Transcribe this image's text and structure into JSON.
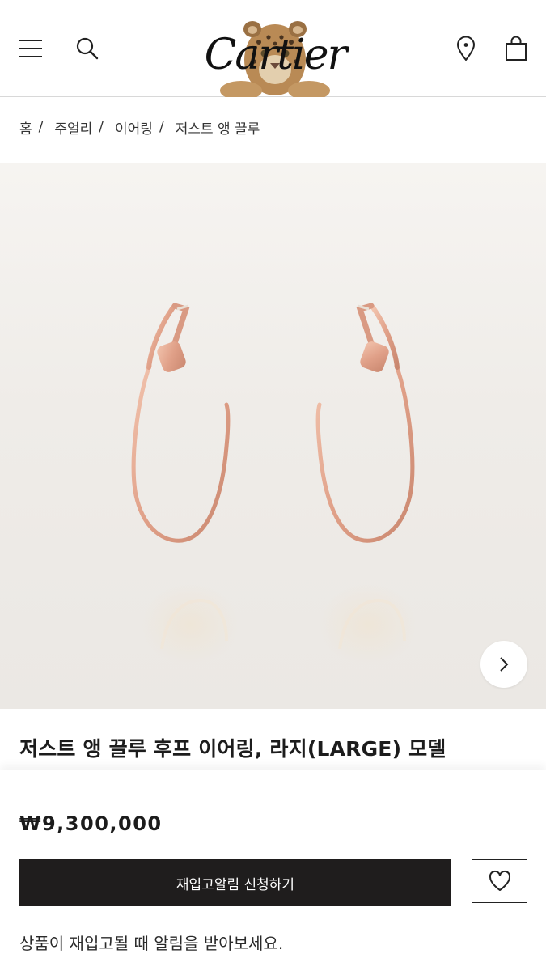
{
  "header": {
    "logo_text": "Cartier",
    "icons": {
      "menu": "hamburger-menu-icon",
      "search": "search-icon",
      "store": "location-pin-icon",
      "bag": "shopping-bag-icon"
    }
  },
  "breadcrumb": {
    "items": [
      "홈",
      "주얼리",
      "이어링",
      "저스트 앵 끌루"
    ],
    "separator": "/"
  },
  "gallery": {
    "next_icon": "chevron-right-icon",
    "image_subject": "rose-gold-nail-hoop-earrings"
  },
  "product": {
    "title": "저스트 앵 끌루 후프 이어링, 라지(LARGE) 모델",
    "price": "₩9,300,000",
    "notify_label": "재입고알림 신청하기",
    "wish_icon": "heart-icon",
    "restock_note": "상품이 재입고될 때 알림을 받아보세요."
  },
  "colors": {
    "button_dark": "#1f1d1d",
    "rose_gold": "#e3a98f",
    "background": "#ffffff"
  }
}
